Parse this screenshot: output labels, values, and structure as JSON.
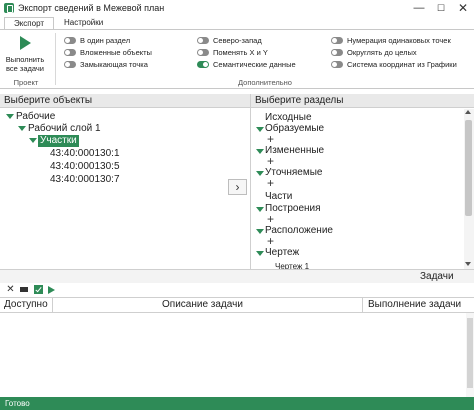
{
  "window": {
    "title": "Экспорт сведений в Межевой план",
    "min_glyph": "—",
    "max_glyph": "☐",
    "close_glyph": "✕",
    "icon": "app-document-icon"
  },
  "ribbon": {
    "tabs": [
      {
        "label": "Экспорт",
        "active": true
      },
      {
        "label": "Настройки",
        "active": false
      }
    ],
    "run_button_label": "Выполнить все задачи",
    "group_project_label": "Проект",
    "group_additional_label": "Дополнительно",
    "toggles": [
      {
        "label": "В один раздел",
        "on": false
      },
      {
        "label": "Вложенные объекты",
        "on": false
      },
      {
        "label": "Замыкающая точка",
        "on": false
      },
      {
        "label": "Северо-запад",
        "on": false
      },
      {
        "label": "Поменять X и Y",
        "on": false
      },
      {
        "label": "Семантические данные",
        "on": true
      },
      {
        "label": "Нумерация одинаковых точек",
        "on": false
      },
      {
        "label": "Округлять до целых",
        "on": false
      },
      {
        "label": "Система координат из Графики",
        "on": false
      }
    ]
  },
  "objects_panel": {
    "header": "Выберите объекты",
    "tree": {
      "root": "Рабочие",
      "layer": "Рабочий слой 1",
      "group": "Участки",
      "leaves": [
        "43:40:000130:1",
        "43:40:000130:5",
        "43:40:000130:7"
      ]
    }
  },
  "move_button_glyph": "›",
  "sections_panel": {
    "header": "Выберите разделы",
    "items": [
      "Исходные",
      "Образуемые",
      "Измененные",
      "Уточняемые",
      "Части",
      "Построения",
      "Расположение",
      "Чертеж",
      "Чертеж 1"
    ],
    "plus_glyph": "+"
  },
  "tasks": {
    "title": "Задачи",
    "close_glyph": "✕",
    "columns": [
      "Доступно",
      "Описание задачи",
      "Выполнение задачи"
    ]
  },
  "status": {
    "text": "Готово"
  },
  "colors": {
    "accent": "#2e8b57"
  }
}
